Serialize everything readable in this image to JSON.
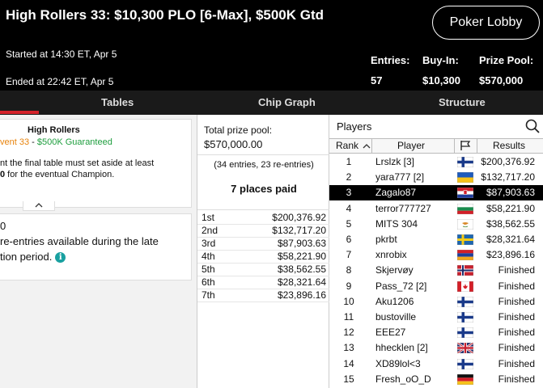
{
  "header": {
    "title": "High Rollers 33: $10,300 PLO [6-Max], $500K Gtd",
    "lobby_button": "Poker Lobby",
    "started": "Started at 14:30 ET, Apr 5",
    "ended": "Ended at 22:42 ET, Apr 5",
    "entries_label": "Entries:",
    "entries_value": "57",
    "buyin_label": "Buy-In:",
    "buyin_value": "$10,300",
    "prizepool_label": "Prize Pool:",
    "prizepool_value": "$570,000"
  },
  "tabs": [
    "Tables",
    "Chip Graph",
    "Structure"
  ],
  "info_card": {
    "title": "High Rollers",
    "event": "vent 33",
    "separator": " - ",
    "guarantee": "$500K Guaranteed",
    "line1": "nt the final table must set aside at least",
    "line2_bold": "0",
    "line2": " for the eventual Champion.",
    "collapse_icon": "chevron-up-icon"
  },
  "reentry_card": {
    "line1": "0",
    "line2": "re-entries available during the late",
    "line3": "tion period.",
    "info_icon": "info-icon"
  },
  "prizes": {
    "total_label": "Total prize pool:",
    "total_value": "$570,000.00",
    "entries_note": "(34 entries, 23 re-entries)",
    "places_paid": "7 places paid",
    "rows": [
      {
        "place": "1st",
        "amount": "$200,376.92"
      },
      {
        "place": "2nd",
        "amount": "$132,717.20"
      },
      {
        "place": "3rd",
        "amount": "$87,903.63"
      },
      {
        "place": "4th",
        "amount": "$58,221.90"
      },
      {
        "place": "5th",
        "amount": "$38,562.55"
      },
      {
        "place": "6th",
        "amount": "$28,321.64"
      },
      {
        "place": "7th",
        "amount": "$23,896.16"
      }
    ]
  },
  "players": {
    "title": "Players",
    "columns": {
      "rank": "Rank",
      "player": "Player",
      "flag": "flag-icon",
      "results": "Results"
    },
    "rows": [
      {
        "rank": "1",
        "name": "Lrslzk [3]",
        "flag": "finland",
        "result": "$200,376.92"
      },
      {
        "rank": "2",
        "name": "yara777 [2]",
        "flag": "ukraine",
        "result": "$132,717.20"
      },
      {
        "rank": "3",
        "name": "Zagalo87",
        "flag": "croatia",
        "result": "$87,903.63",
        "selected": true
      },
      {
        "rank": "4",
        "name": "terror777727",
        "flag": "bulgaria",
        "result": "$58,221.90"
      },
      {
        "rank": "5",
        "name": "MITS 304",
        "flag": "cyprus",
        "result": "$38,562.55"
      },
      {
        "rank": "6",
        "name": "pkrbt",
        "flag": "sweden",
        "result": "$28,321.64"
      },
      {
        "rank": "7",
        "name": "xnrobix",
        "flag": "armenia",
        "result": "$23,896.16"
      },
      {
        "rank": "8",
        "name": "Skjervøy",
        "flag": "norway",
        "result": "Finished"
      },
      {
        "rank": "9",
        "name": "Pass_72 [2]",
        "flag": "canada",
        "result": "Finished"
      },
      {
        "rank": "10",
        "name": "Aku1206",
        "flag": "finland",
        "result": "Finished"
      },
      {
        "rank": "11",
        "name": "bustoville",
        "flag": "finland",
        "result": "Finished"
      },
      {
        "rank": "12",
        "name": "EEE27",
        "flag": "finland",
        "result": "Finished"
      },
      {
        "rank": "13",
        "name": "hhecklen [2]",
        "flag": "uk",
        "result": "Finished"
      },
      {
        "rank": "14",
        "name": "XD89lol<3",
        "flag": "finland",
        "result": "Finished"
      },
      {
        "rank": "15",
        "name": "Fresh_oO_D",
        "flag": "germany",
        "result": "Finished"
      }
    ]
  },
  "colors": {
    "accent_red": "#d4232b",
    "event_orange": "#e8830c",
    "guarantee_green": "#1e9e3e",
    "info_teal": "#19a0a0"
  }
}
